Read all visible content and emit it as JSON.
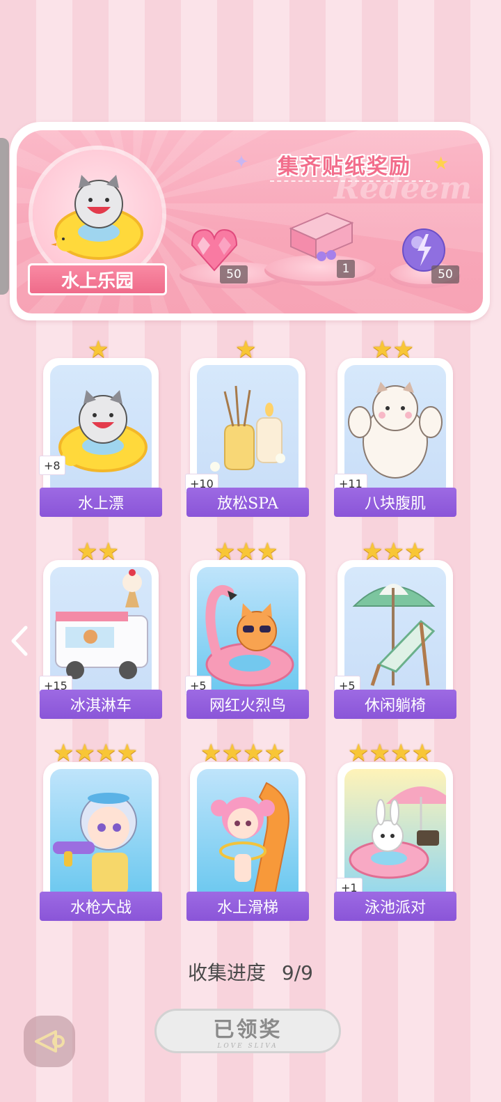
{
  "header": {
    "title": "集齐贴纸奖励",
    "watermark": "Redeem",
    "album_name": "水上乐园",
    "rewards": [
      {
        "icon": "pink-heart-gem-icon",
        "count": "50"
      },
      {
        "icon": "gift-box-icon",
        "count": "1"
      },
      {
        "icon": "purple-lightning-orb-icon",
        "count": "50"
      }
    ]
  },
  "stickers": [
    {
      "name": "水上漂",
      "stars": 1,
      "bonus": "+8",
      "icon": "cat-swim-ring-icon"
    },
    {
      "name": "放松SPA",
      "stars": 1,
      "bonus": "+10",
      "icon": "aroma-candle-icon"
    },
    {
      "name": "八块腹肌",
      "stars": 2,
      "bonus": "+11",
      "icon": "muscle-cat-icon"
    },
    {
      "name": "冰淇淋车",
      "stars": 2,
      "bonus": "+15",
      "icon": "ice-cream-truck-icon"
    },
    {
      "name": "网红火烈鸟",
      "stars": 3,
      "bonus": "+5",
      "icon": "flamingo-float-icon"
    },
    {
      "name": "休闲躺椅",
      "stars": 3,
      "bonus": "+5",
      "icon": "beach-chair-icon"
    },
    {
      "name": "水枪大战",
      "stars": 4,
      "bonus": "",
      "icon": "water-gun-boy-icon"
    },
    {
      "name": "水上滑梯",
      "stars": 4,
      "bonus": "",
      "icon": "water-slide-girl-icon"
    },
    {
      "name": "泳池派对",
      "stars": 4,
      "bonus": "+1",
      "icon": "bunny-pool-party-icon"
    }
  ],
  "progress": {
    "label": "收集进度",
    "value": "9/9"
  },
  "claim_button": {
    "label": "已领奖",
    "sub": "LOVE SLIVA"
  },
  "colors": {
    "accent": "#8a55d8",
    "pink": "#f26d8b",
    "star": "#f8c636"
  }
}
